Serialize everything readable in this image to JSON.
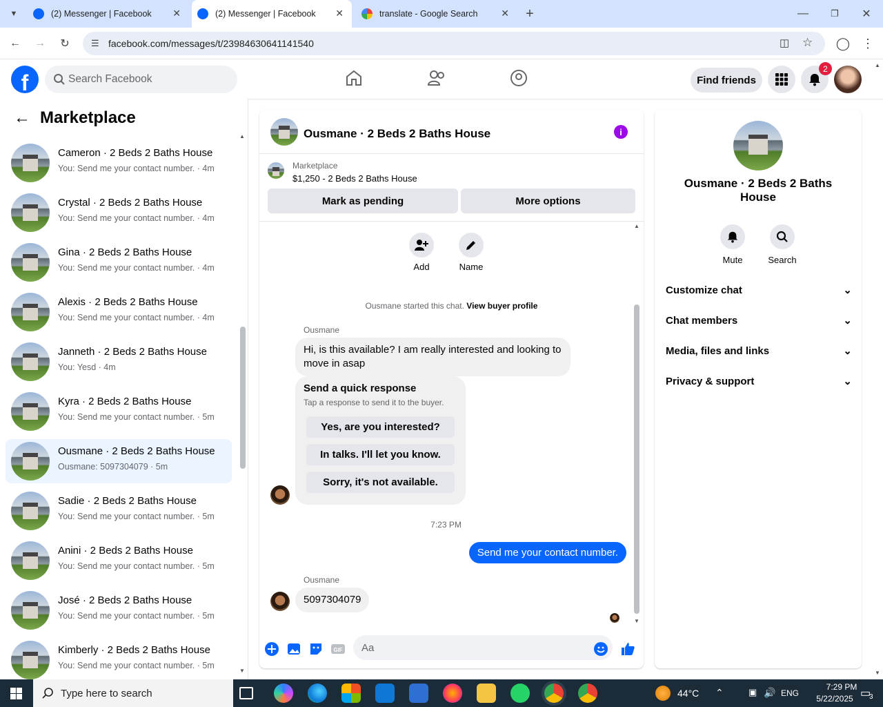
{
  "browser": {
    "tabs": [
      {
        "title": "(2) Messenger | Facebook",
        "active": false
      },
      {
        "title": "(2) Messenger | Facebook",
        "active": true
      },
      {
        "title": "translate - Google Search",
        "active": false
      }
    ],
    "url": "facebook.com/messages/t/23984630641141540"
  },
  "fb": {
    "search_placeholder": "Search Facebook",
    "find_friends": "Find friends",
    "notif_count": "2"
  },
  "left": {
    "title": "Marketplace",
    "conversations": [
      {
        "name": "Cameron · 2 Beds 2 Baths House",
        "sub": "You: Send me your contact number. · 4m"
      },
      {
        "name": "Crystal · 2 Beds 2 Baths House",
        "sub": "You: Send me your contact number. · 4m"
      },
      {
        "name": "Gina · 2 Beds 2 Baths House",
        "sub": "You: Send me your contact number. · 4m"
      },
      {
        "name": "Alexis · 2 Beds 2 Baths House",
        "sub": "You: Send me your contact number. · 4m"
      },
      {
        "name": "Janneth · 2 Beds 2 Baths House",
        "sub": "You: Yesd · 4m"
      },
      {
        "name": "Kyra · 2 Beds 2 Baths House",
        "sub": "You: Send me your contact number. · 5m"
      },
      {
        "name": "Ousmane · 2 Beds 2 Baths House",
        "sub": "Ousmane: 5097304079 · 5m",
        "selected": true
      },
      {
        "name": "Sadie · 2 Beds 2 Baths House",
        "sub": "You: Send me your contact number. · 5m"
      },
      {
        "name": "Anini · 2 Beds 2 Baths House",
        "sub": "You: Send me your contact number. · 5m"
      },
      {
        "name": "José · 2 Beds 2 Baths House",
        "sub": "You: Send me your contact number. · 5m"
      },
      {
        "name": "Kimberly · 2 Beds 2 Baths House",
        "sub": "You: Send me your contact number. · 5m"
      }
    ]
  },
  "chat": {
    "title": "Ousmane · 2 Beds 2 Baths House",
    "marketplace_label": "Marketplace",
    "listing": "$1,250 - 2 Beds 2 Baths House",
    "mark_pending": "Mark as pending",
    "more_options": "More options",
    "add_label": "Add",
    "name_label": "Name",
    "started_text": "Ousmane started this chat.",
    "view_buyer": "View buyer profile",
    "sender": "Ousmane",
    "msg1": "Hi, is this available? I am really interested and looking to move in asap",
    "quick_title": "Send a quick response",
    "quick_sub": "Tap a response to send it to the buyer.",
    "quick_replies": [
      "Yes, are you interested?",
      "In talks. I'll let you know.",
      "Sorry, it's not available."
    ],
    "time": "7:23 PM",
    "my_msg": "Send me your contact number.",
    "msg2": "5097304079",
    "input_placeholder": "Aa"
  },
  "right": {
    "title": "Ousmane · 2 Beds 2 Baths House",
    "mute": "Mute",
    "search": "Search",
    "sections": [
      "Customize chat",
      "Chat members",
      "Media, files and links",
      "Privacy & support"
    ]
  },
  "taskbar": {
    "search_placeholder": "Type here to search",
    "temp": "44°C",
    "lang": "ENG",
    "time": "7:29 PM",
    "date": "5/22/2025",
    "notif": "3"
  },
  "colors": {
    "fb_blue": "#0866ff",
    "info_purple": "#9b0de8",
    "badge_red": "#e41e3f"
  }
}
